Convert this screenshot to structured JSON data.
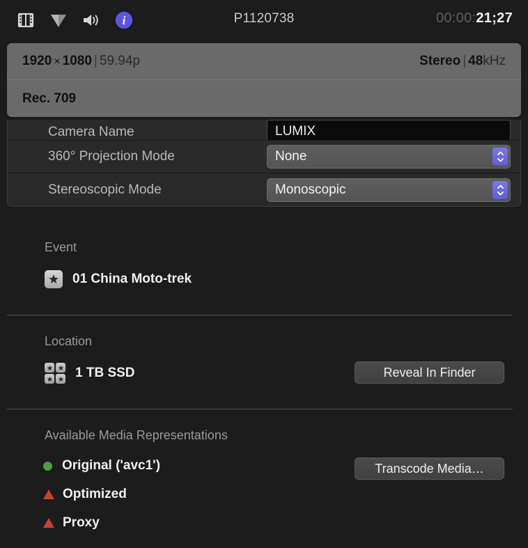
{
  "toolbar": {
    "icons": [
      {
        "name": "film-strip-icon",
        "label": "Video"
      },
      {
        "name": "triangle-down-icon",
        "label": "Markers"
      },
      {
        "name": "speaker-icon",
        "label": "Audio"
      },
      {
        "name": "info-icon",
        "label": "Info"
      }
    ],
    "clip_title": "P1120738",
    "timecode_dim": "00:00:",
    "timecode_bright": "21;27"
  },
  "summary": {
    "video_width": "1920",
    "video_x": "×",
    "video_height": "1080",
    "video_sep": "|",
    "frame_rate": "59.94p",
    "audio_channels": "Stereo",
    "audio_sep": "|",
    "audio_rate_num": "48",
    "audio_rate_unit": "kHz",
    "color_space": "Rec. 709"
  },
  "properties": [
    {
      "label": "Camera Name",
      "control": "text",
      "value": "LUMIX"
    },
    {
      "label": "360° Projection Mode",
      "control": "popup",
      "value": "None"
    },
    {
      "label": "Stereoscopic Mode",
      "control": "popup",
      "value": "Monoscopic"
    }
  ],
  "event": {
    "title": "Event",
    "icon": "event-star-icon",
    "name": "01 China Moto-trek"
  },
  "location": {
    "title": "Location",
    "icon": "library-grid-icon",
    "name": "1 TB SSD",
    "button": "Reveal In Finder"
  },
  "media": {
    "title": "Available Media Representations",
    "button": "Transcode Media…",
    "items": [
      {
        "label": "Original ('avc1')",
        "status": "available",
        "marker": "circle",
        "color": "#4f9c4a"
      },
      {
        "label": "Optimized",
        "status": "unavailable",
        "marker": "triangle",
        "color": "#c4452f"
      },
      {
        "label": "Proxy",
        "status": "unavailable",
        "marker": "triangle",
        "color": "#c4452f"
      }
    ]
  },
  "colors": {
    "window_bg": "#1c1c1c",
    "summary_bg": "#6a6a6a",
    "accent_stepper": "#6b68e0",
    "info_icon": "#5b56e0"
  }
}
